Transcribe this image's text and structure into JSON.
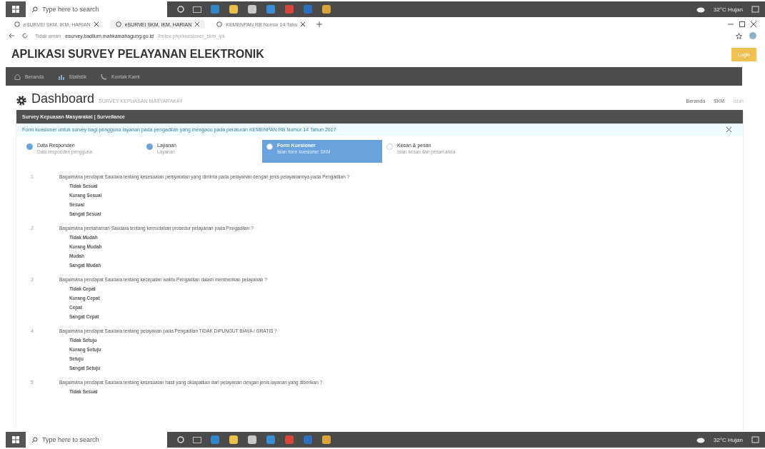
{
  "taskbar_top": {
    "search_placeholder": "Type here to search",
    "weather": "32°C Hujan"
  },
  "browser": {
    "tabs": [
      {
        "title": "eSURVEI SKM, IKM, HARIAN",
        "selected": false
      },
      {
        "title": "eSURVEI SKM, IKM, HARIAN",
        "selected": true
      },
      {
        "title": "KEMENPAN RB Nomor 14 Tahu",
        "selected": false
      }
    ],
    "address": {
      "security": "Tidak aman",
      "url": "esurvey.badilum.mahkamahagung.go.id",
      "path": "/index.php/kuesioner_skm_ipk"
    }
  },
  "header": {
    "title": "APLIKASI SURVEY PELAYANAN ELEKTRONIK",
    "login": "Login"
  },
  "nav": [
    {
      "label": "Beranda"
    },
    {
      "label": "Statistik"
    },
    {
      "label": "Kontak Kami"
    }
  ],
  "dashboard": {
    "title": "Dashboard",
    "subtitle": "SURVEY KEPUASAN MASYARAKAT",
    "breadcrumb": [
      "Beranda",
      "SKM",
      "Isian"
    ]
  },
  "panel": {
    "header": "Survey Kepuasan Masyarakat | Surveilance",
    "alert": "Form kuesioner untuk survey bagi pengguna layanan pada pengadilan yang mengacu pada peraturan KEMENPAN RB Nomor 14 Tahun 2017",
    "steps": [
      {
        "title": "Data Responden",
        "subtitle": "Data responden pengguna",
        "completed": true,
        "selected": false
      },
      {
        "title": "Layanan",
        "subtitle": "Layanan",
        "completed": true,
        "selected": false
      },
      {
        "title": "Form Kuesioner",
        "subtitle": "Isian form kuesioner SKM",
        "completed": false,
        "selected": true
      },
      {
        "title": "Kesan & pesan",
        "subtitle": "Isian kesan dan pesan anda",
        "completed": false,
        "selected": false
      }
    ],
    "questions": [
      {
        "number": "1",
        "text": "Bagaimana pendapat Saudara tentang kesesuaian persyaratan yang diminta pada pelayanan dengan jenis pelayanannya pada Pengadilan ?",
        "options": [
          "Tidak Sesuai",
          "Kurang Sesuai",
          "Sesuai",
          "Sangat Sesuai"
        ]
      },
      {
        "number": "2",
        "text": "Bagaimana pemahaman Saudara tentang kemudahan prosedur pelayanan pada Pengadilan ?",
        "options": [
          "Tidak Mudah",
          "Kurang Mudah",
          "Mudah",
          "Sangat Mudah"
        ]
      },
      {
        "number": "3",
        "text": "Bagaimana pendapat Saudara tentang kecepatan waktu Pengadilan dalam memberikan pelayanan ?",
        "options": [
          "Tidak Cepat",
          "Kurang Cepat",
          "Cepat",
          "Sangat Cepat"
        ]
      },
      {
        "number": "4",
        "text": "Bagaimana pendapat Saudara tentang pelayanan pada Pengadilan TIDAK DIPUNGUT BIAYA / GRATIS ?",
        "options": [
          "Tidak Setuju",
          "Kurang Setuju",
          "Setuju",
          "Sangat Setuju"
        ]
      },
      {
        "number": "5",
        "text": "Bagaimana pendapat Saudara tentang kesesuaian hasil yang didapatkan dari pelayanan dengan jenis layanan yang diberikan ?",
        "options": [
          "Tidak Sesuai"
        ]
      }
    ]
  },
  "taskbar_bottom": {
    "search_placeholder": "Type here to search",
    "weather": "32°C Hujan"
  }
}
